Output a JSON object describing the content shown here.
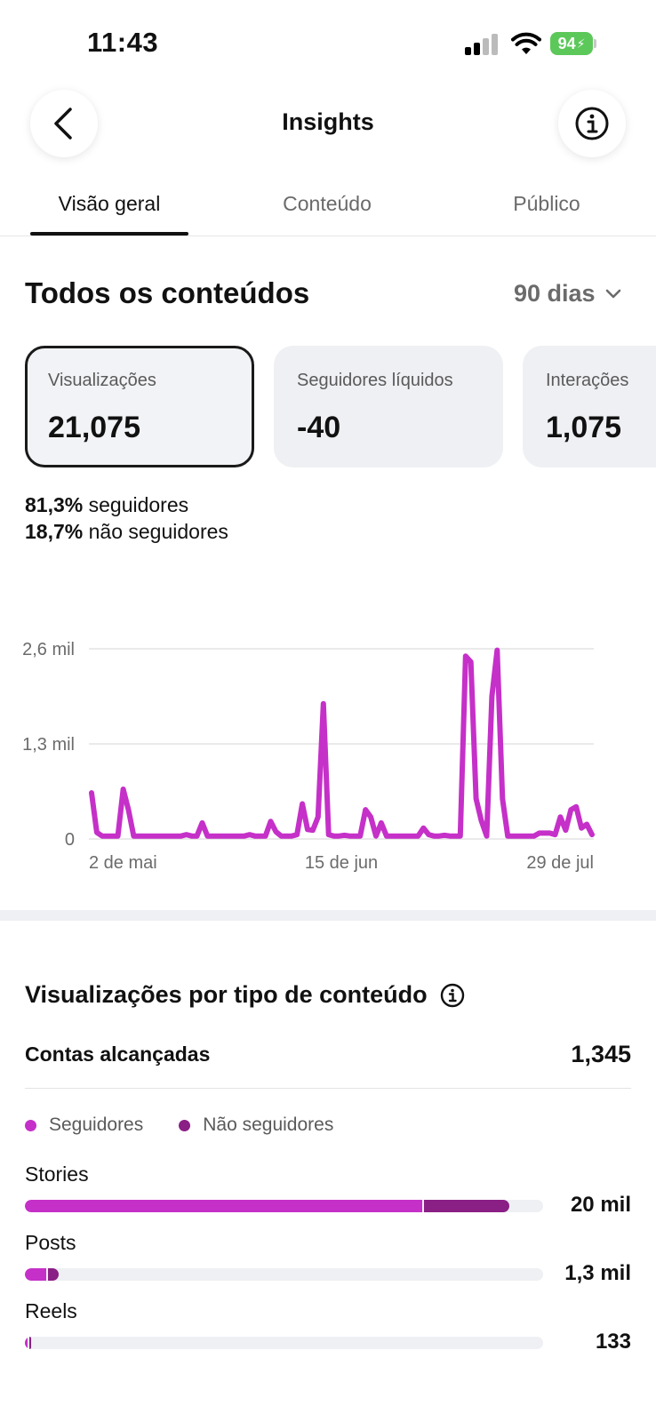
{
  "status_bar": {
    "time": "11:43",
    "battery": "94"
  },
  "header": {
    "title": "Insights",
    "back_icon": "chevron-left-icon",
    "info_icon": "info-icon"
  },
  "tabs": [
    {
      "label": "Visão geral",
      "active": true
    },
    {
      "label": "Conteúdo",
      "active": false
    },
    {
      "label": "Público",
      "active": false
    }
  ],
  "overview": {
    "title": "Todos os conteúdos",
    "range": "90 dias",
    "cards": [
      {
        "label": "Visualizações",
        "value": "21,075",
        "selected": true
      },
      {
        "label": "Seguidores líquidos",
        "value": "-40",
        "selected": false
      },
      {
        "label": "Interações",
        "value": "1,075",
        "selected": false
      }
    ],
    "breakdown": {
      "followers_pct": "81,3%",
      "followers_label": "seguidores",
      "non_followers_pct": "18,7%",
      "non_followers_label": "não seguidores"
    }
  },
  "chart_data": {
    "type": "line",
    "y_tick_labels": [
      "0",
      "1,3 mil",
      "2,6 mil"
    ],
    "y_ticks": [
      0,
      1300,
      2600
    ],
    "ylim": [
      0,
      2600
    ],
    "x_tick_labels": [
      "2 de mai",
      "15 de jun",
      "29 de jul"
    ],
    "x_range": [
      "2025-05-01",
      "2025-07-30"
    ],
    "color": "#c530c8",
    "series": [
      {
        "values": [
          630,
          90,
          40,
          40,
          40,
          40,
          680,
          400,
          40,
          40,
          40,
          40,
          40,
          40,
          40,
          40,
          40,
          40,
          60,
          40,
          40,
          220,
          40,
          40,
          40,
          40,
          40,
          40,
          40,
          40,
          60,
          40,
          40,
          40,
          240,
          100,
          40,
          40,
          40,
          60,
          480,
          130,
          120,
          300,
          1850,
          60,
          40,
          40,
          50,
          40,
          40,
          40,
          400,
          300,
          40,
          220,
          40,
          40,
          40,
          40,
          40,
          40,
          40,
          150,
          60,
          40,
          40,
          50,
          40,
          40,
          40,
          2500,
          2420,
          550,
          250,
          40,
          1950,
          2580,
          550,
          40,
          40,
          40,
          40,
          40,
          40,
          80,
          80,
          80,
          60,
          300,
          120,
          400,
          440,
          150,
          200,
          60
        ]
      }
    ]
  },
  "content_type": {
    "title": "Visualizações por tipo de conteúdo",
    "info_icon": "info-icon",
    "reach_label": "Contas alcançadas",
    "reach_value": "1,345",
    "legend": [
      {
        "label": "Seguidores",
        "color": "#c530c8"
      },
      {
        "label": "Não seguidores",
        "color": "#8a1f85"
      }
    ],
    "rows": [
      {
        "label": "Stories",
        "value": "20 mil",
        "followers_fraction": 0.767,
        "non_followers_fraction": 0.165
      },
      {
        "label": "Posts",
        "value": "1,3 mil",
        "followers_fraction": 0.041,
        "non_followers_fraction": 0.021
      },
      {
        "label": "Reels",
        "value": "133",
        "followers_fraction": 0.004,
        "non_followers_fraction": 0.003
      }
    ]
  }
}
